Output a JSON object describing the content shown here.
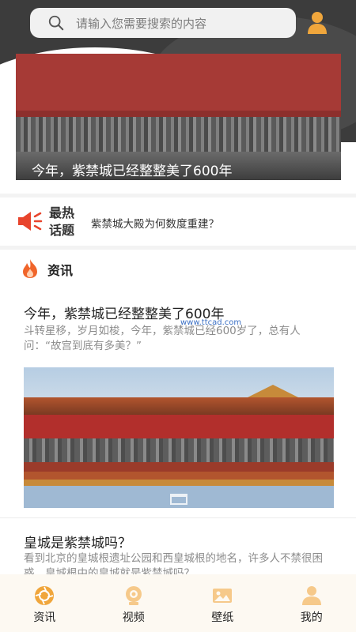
{
  "search": {
    "placeholder": "请输入您需要搜索的内容"
  },
  "banner": {
    "caption": "今年，紫禁城已经整整美了600年"
  },
  "hot_topic": {
    "title": "最热话题",
    "text": "紫禁城大殿为何数度重建？"
  },
  "news": {
    "label": "资讯"
  },
  "articles": [
    {
      "title": "今年，紫禁城已经整整美了600年",
      "summary": "斗转星移，岁月如梭，今年，紫禁城已经600岁了，总有人问：“故宫到底有多美？”"
    },
    {
      "title": "皇城是紫禁城吗？",
      "summary": "看到北京的皇城根遗址公园和西皇城根的地名，许多人不禁很困惑，皇城根中的皇城就是紫禁城吗？"
    }
  ],
  "watermark": "www.ttcad.com",
  "nav": [
    {
      "label": "资讯",
      "icon": "aperture-icon"
    },
    {
      "label": "视频",
      "icon": "video-camera-icon"
    },
    {
      "label": "壁纸",
      "icon": "picture-icon"
    },
    {
      "label": "我的",
      "icon": "user-icon"
    }
  ],
  "colors": {
    "accent": "#f0a63c",
    "nav_bg": "#fdf9f2",
    "hot_red": "#e8442c"
  }
}
